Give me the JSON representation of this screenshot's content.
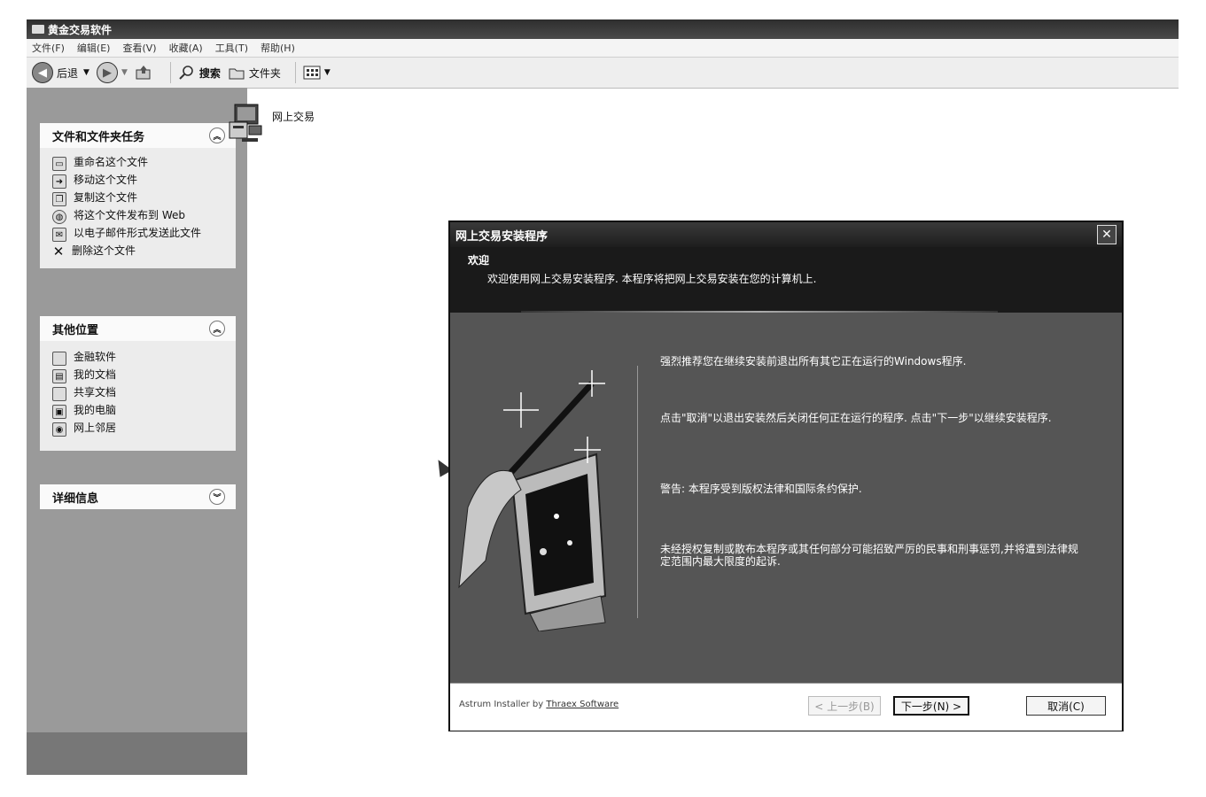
{
  "window": {
    "title": "黄金交易软件"
  },
  "menubar": {
    "items": [
      "文件(F)",
      "编辑(E)",
      "查看(V)",
      "收藏(A)",
      "工具(T)",
      "帮助(H)"
    ]
  },
  "toolbar": {
    "back": "后退",
    "search": "搜索",
    "folders": "文件夹"
  },
  "sidebar": {
    "file_tasks": {
      "title": "文件和文件夹任务",
      "items": [
        {
          "label": "重命名这个文件",
          "icon": "rename-icon"
        },
        {
          "label": "移动这个文件",
          "icon": "move-icon"
        },
        {
          "label": "复制这个文件",
          "icon": "copy-icon"
        },
        {
          "label": "将这个文件发布到 Web",
          "icon": "web-publish-icon"
        },
        {
          "label": "以电子邮件形式发送此文件",
          "icon": "email-icon"
        },
        {
          "label": "删除这个文件",
          "icon": "delete-icon"
        }
      ]
    },
    "other_places": {
      "title": "其他位置",
      "items": [
        {
          "label": "金融软件",
          "icon": "folder-icon"
        },
        {
          "label": "我的文档",
          "icon": "documents-icon"
        },
        {
          "label": "共享文档",
          "icon": "folder-icon"
        },
        {
          "label": "我的电脑",
          "icon": "computer-icon"
        },
        {
          "label": "网上邻居",
          "icon": "network-icon"
        }
      ]
    },
    "details": {
      "title": "详细信息"
    }
  },
  "content": {
    "file_label": "网上交易"
  },
  "dialog": {
    "title": "网上交易安装程序",
    "header_title": "欢迎",
    "header_desc": "欢迎使用网上交易安装程序. 本程序将把网上交易安装在您的计算机上.",
    "paragraphs": [
      "强烈推荐您在继续安装前退出所有其它正在运行的Windows程序.",
      "点击\"取消\"以退出安装然后关闭任何正在运行的程序. 点击\"下一步\"以继续安装程序.",
      "警告: 本程序受到版权法律和国际条约保护.",
      "未经授权复制或散布本程序或其任何部分可能招致严厉的民事和刑事惩罚,并将遭到法律规定范围内最大限度的起诉."
    ],
    "credit_prefix": "Astrum Installer by ",
    "credit_link": "Thraex Software",
    "buttons": {
      "back": "< 上一步(B)",
      "next": "下一步(N) >",
      "cancel": "取消(C)"
    }
  }
}
